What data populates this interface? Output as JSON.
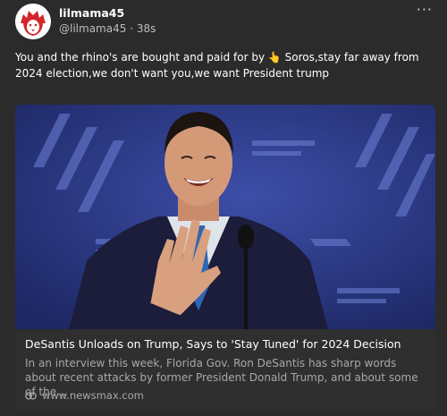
{
  "post": {
    "author": "lilmama45",
    "handle": "@lilmama45",
    "separator": "·",
    "time": "38s",
    "more_label": "···",
    "text_before_emoji": "You and the rhino's are bought and paid for by ",
    "emoji": "👆",
    "text_after_emoji": " Soros,stay far away from 2024 election,we don't want you,we want President trump"
  },
  "card": {
    "title": "DeSantis Unloads on Trump, Says to 'Stay Tuned' for 2024 Decision",
    "description": "In an interview this week, Florida Gov. Ron DeSantis has sharp words about recent attacks by former President Donald Trump, and about some of the...",
    "domain": "www.newsmax.com"
  },
  "icons": {
    "avatar": "lion-logo-icon",
    "more": "more-horizontal-icon",
    "link": "link-icon"
  },
  "colors": {
    "background": "#2b2b2b",
    "card_body": "#2f2f2f",
    "muted_text": "#bdbdbd",
    "stage_blue": "#2d3a86"
  }
}
